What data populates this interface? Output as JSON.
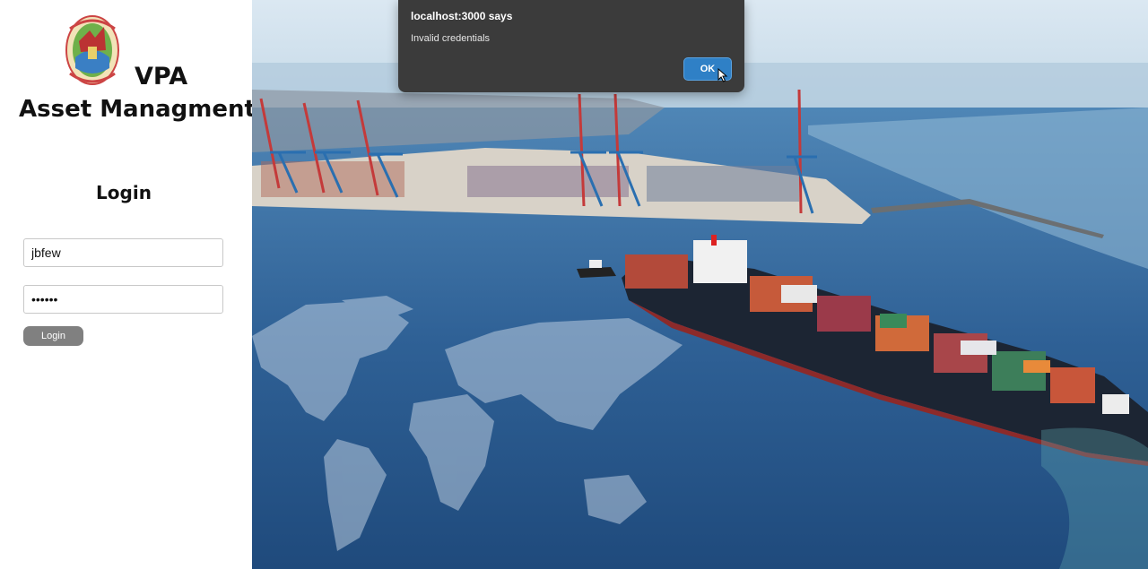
{
  "sidebar": {
    "brand_line1": "VPA",
    "brand_line2": "Asset Managment",
    "login_heading": "Login",
    "username_value": "jbfew",
    "password_value": "••••••",
    "login_button": "Login",
    "logo_icon": "vpa-emblem-icon"
  },
  "dialog": {
    "title": "localhost:3000 says",
    "message": "Invalid credentials",
    "ok_label": "OK"
  },
  "colors": {
    "login_button": "#808080",
    "dialog_bg": "#3b3b3b",
    "ok_button": "#2f80c6",
    "sea": "#2d5f93",
    "sky": "#cfe1ee"
  }
}
